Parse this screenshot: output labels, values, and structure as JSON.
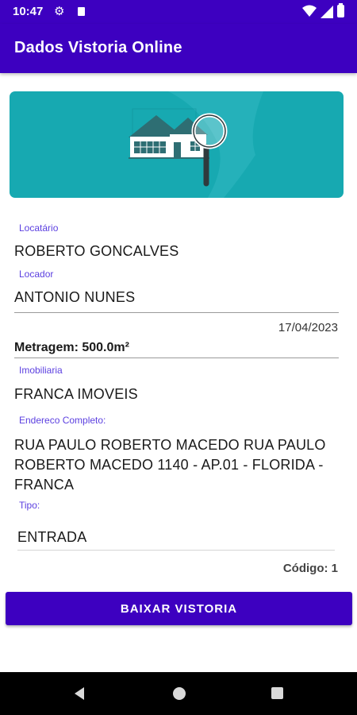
{
  "status_bar": {
    "time": "10:47",
    "icons": [
      "gear-icon",
      "sd-card-icon",
      "wifi-icon",
      "signal-icon",
      "battery-icon"
    ]
  },
  "app_bar": {
    "title": "Dados Vistoria Online"
  },
  "banner": {
    "image": "house-magnifier-illustration"
  },
  "fields": {
    "locatario": {
      "label": "Locatário",
      "value": "ROBERTO GONCALVES"
    },
    "locador": {
      "label": "Locador",
      "value": "ANTONIO NUNES"
    },
    "date": "17/04/2023",
    "metragem": "Metragem: 500.0m²",
    "imobiliaria": {
      "label": "Imobiliaria",
      "value": "FRANCA IMOVEIS"
    },
    "endereco": {
      "label": "Endereco Completo:",
      "value": "RUA PAULO ROBERTO MACEDO RUA PAULO ROBERTO MACEDO 1140 - AP.01 - FLORIDA - FRANCA"
    },
    "tipo": {
      "label": "Tipo:",
      "value": "ENTRADA"
    },
    "codigo": "Código: 1"
  },
  "actions": {
    "download_label": "BAIXAR VISTORIA"
  },
  "nav_bar": {
    "icons": [
      "back-icon",
      "home-icon",
      "recents-icon"
    ]
  },
  "colors": {
    "primary": "#3d00c0",
    "banner": "#17a9b1",
    "label": "#5b3fe0"
  }
}
